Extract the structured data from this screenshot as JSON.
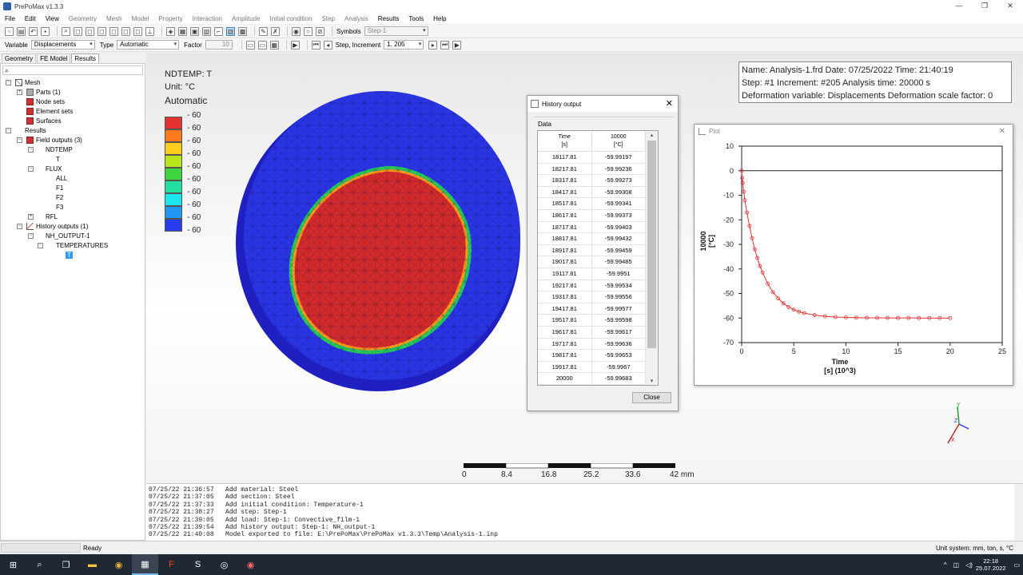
{
  "window": {
    "title": "PrePoMax v1.3.3",
    "min": "—",
    "restore": "❐",
    "close": "✕"
  },
  "menu": [
    "File",
    "Edit",
    "View",
    "Geometry",
    "Mesh",
    "Model",
    "Property",
    "Interaction",
    "Amplitude",
    "Initial condition",
    "Step",
    "Analysis",
    "Results",
    "Tools",
    "Help"
  ],
  "toolbar": {
    "symbols_label": "Symbols",
    "symbols_value": "Step-1",
    "variable_label": "Variable",
    "variable_value": "Displacements",
    "type_label": "Type",
    "type_value": "Automatic",
    "factor_label": "Factor",
    "factor_value": "10",
    "step_label": "Step, Increment",
    "step_value": "1, 205"
  },
  "tabs": [
    "Geometry",
    "FE Model",
    "Results"
  ],
  "tree": {
    "mesh": "Mesh",
    "parts": "Parts (1)",
    "node_sets": "Node sets",
    "element_sets": "Element sets",
    "surfaces": "Surfaces",
    "results": "Results",
    "field_outputs": "Field outputs (3)",
    "ndtemp": "NDTEMP",
    "t": "T",
    "flux": "FLUX",
    "all": "ALL",
    "f1": "F1",
    "f2": "F2",
    "f3": "F3",
    "rfl": "RFL",
    "history_outputs": "History outputs (1)",
    "nh_output": "NH_OUTPUT-1",
    "temperatures": "TEMPERATURES",
    "t_sel": "T"
  },
  "legend": {
    "title": "NDTEMP: T",
    "unit": "Unit: °C",
    "mode": "Automatic",
    "values": [
      "- 60",
      "- 60",
      "- 60",
      "- 60",
      "- 60",
      "- 60",
      "- 60",
      "- 60",
      "- 60",
      "- 60"
    ],
    "colors": [
      "#e53232",
      "#ff7a1f",
      "#ffcc1a",
      "#b8e61a",
      "#3ed43e",
      "#22e0a0",
      "#1ae6f0",
      "#2196f3",
      "#2b3cf0"
    ]
  },
  "info": {
    "line1": "Name: Analysis-1.frd   Date: 07/25/2022   Time: 21:40:19",
    "line2": "Step: #1   Increment: #205   Analysis time: 20000 s",
    "line3": "Deformation variable: Displacements   Deformation scale factor: 0"
  },
  "history_dialog": {
    "title": "History output",
    "group": "Data",
    "col1": "Time",
    "col1_unit": "[s]",
    "col2": "10000",
    "col2_unit": "[°C]",
    "rows": [
      [
        "18117.81",
        "-59.99197"
      ],
      [
        "18217.81",
        "-59.99236"
      ],
      [
        "18317.81",
        "-59.99273"
      ],
      [
        "18417.81",
        "-59.99308"
      ],
      [
        "18517.81",
        "-59.99341"
      ],
      [
        "18617.81",
        "-59.99373"
      ],
      [
        "18717.81",
        "-59.99403"
      ],
      [
        "18817.81",
        "-59.99432"
      ],
      [
        "18917.81",
        "-59.99459"
      ],
      [
        "19017.81",
        "-59.99485"
      ],
      [
        "19117.81",
        "-59.9951"
      ],
      [
        "19217.81",
        "-59.99534"
      ],
      [
        "19317.81",
        "-59.99556"
      ],
      [
        "19417.81",
        "-59.99577"
      ],
      [
        "19517.81",
        "-59.99598"
      ],
      [
        "19617.81",
        "-59.99617"
      ],
      [
        "19717.81",
        "-59.99636"
      ],
      [
        "19817.81",
        "-59.99653"
      ],
      [
        "19917.81",
        "-59.9967"
      ],
      [
        "20000",
        "-59.99683"
      ]
    ],
    "close": "Close"
  },
  "plot": {
    "title": "Plot",
    "close": "✕"
  },
  "chart_data": {
    "type": "scatter",
    "title": "",
    "xlabel": "Time\n[s] (10^3)",
    "ylabel": "10000\n[°C]",
    "xlim": [
      0,
      25
    ],
    "ylim": [
      -70,
      10
    ],
    "xticks": [
      "0",
      "5",
      "10",
      "15",
      "20",
      "25"
    ],
    "yticks": [
      "10",
      "0",
      "-10",
      "-20",
      "-30",
      "-40",
      "-50",
      "-60",
      "-70"
    ],
    "series": [
      {
        "name": "10000",
        "color": "#e03030",
        "x": [
          0,
          0.05,
          0.1,
          0.2,
          0.3,
          0.5,
          0.75,
          1,
          1.25,
          1.5,
          1.75,
          2,
          2.5,
          3,
          3.5,
          4,
          4.5,
          5,
          5.5,
          6,
          7,
          8,
          9,
          10,
          11,
          12,
          13,
          14,
          15,
          16,
          17,
          18,
          19,
          20
        ],
        "y": [
          0,
          -3,
          -5,
          -8.5,
          -12,
          -17,
          -22.5,
          -27.5,
          -32,
          -35.5,
          -38.8,
          -41.5,
          -46,
          -49.5,
          -52,
          -54,
          -55.5,
          -56.6,
          -57.4,
          -58,
          -58.8,
          -59.3,
          -59.6,
          -59.75,
          -59.84,
          -59.9,
          -59.93,
          -59.95,
          -59.96,
          -59.97,
          -59.98,
          -59.99,
          -59.995,
          -59.997
        ]
      }
    ]
  },
  "scale": {
    "labels": [
      "0",
      "8.4",
      "16.8",
      "25.2",
      "33.6",
      "42 mm"
    ]
  },
  "console": [
    "07/25/22 21:36:57   Add material: Steel",
    "07/25/22 21:37:05   Add section: Steel",
    "07/25/22 21:37:33   Add initial condition: Temperature-1",
    "07/25/22 21:38:27   Add step: Step-1",
    "07/25/22 21:39:05   Add load: Step-1: Convective_film-1",
    "07/25/22 21:39:54   Add history output: Step-1: NH_output-1",
    "07/25/22 21:40:08   Model exported to file: E:\\PrePoMax\\PrePoMax v1.3.3\\Temp\\Analysis-1.inp"
  ],
  "status": {
    "text": "Ready",
    "units": "Unit system: mm, ton, s, °C"
  },
  "taskbar": {
    "time": "22:18",
    "date": "25.07.2022"
  }
}
